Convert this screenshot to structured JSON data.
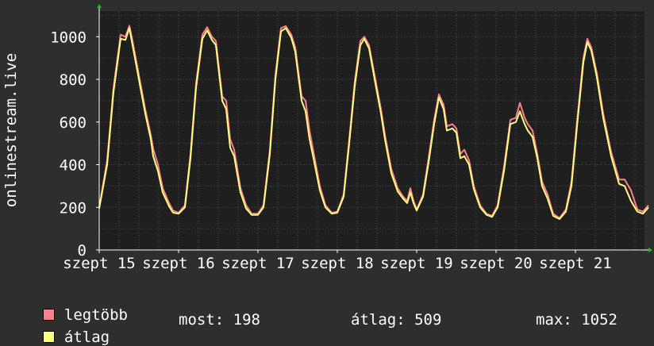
{
  "chart_data": {
    "type": "line",
    "ylabel": "onlinestream.live",
    "ylim": [
      0,
      1120
    ],
    "y_ticks": [
      0,
      200,
      400,
      600,
      800,
      1000
    ],
    "x_tick_labels": [
      "szept 15",
      "szept 16",
      "szept 17",
      "szept 18",
      "szept 19",
      "szept 20",
      "szept 21"
    ],
    "grid": true,
    "background": "#1f1f1f",
    "gridColor": "#4a4a4a",
    "series": [
      {
        "name": "legtöbb",
        "color": "#ff7f8a",
        "points": [
          [
            0,
            200
          ],
          [
            0.1,
            420
          ],
          [
            0.18,
            760
          ],
          [
            0.27,
            1010
          ],
          [
            0.33,
            1000
          ],
          [
            0.38,
            1052
          ],
          [
            0.42,
            980
          ],
          [
            0.5,
            820
          ],
          [
            0.58,
            660
          ],
          [
            0.65,
            540
          ],
          [
            0.68,
            475
          ],
          [
            0.74,
            400
          ],
          [
            0.8,
            290
          ],
          [
            0.88,
            220
          ],
          [
            0.93,
            185
          ],
          [
            1.0,
            175
          ],
          [
            1.08,
            210
          ],
          [
            1.15,
            450
          ],
          [
            1.22,
            780
          ],
          [
            1.3,
            1010
          ],
          [
            1.36,
            1045
          ],
          [
            1.42,
            1000
          ],
          [
            1.47,
            980
          ],
          [
            1.55,
            720
          ],
          [
            1.6,
            700
          ],
          [
            1.65,
            520
          ],
          [
            1.7,
            470
          ],
          [
            1.78,
            290
          ],
          [
            1.85,
            210
          ],
          [
            1.92,
            170
          ],
          [
            2.0,
            170
          ],
          [
            2.07,
            210
          ],
          [
            2.15,
            470
          ],
          [
            2.22,
            820
          ],
          [
            2.29,
            1040
          ],
          [
            2.35,
            1050
          ],
          [
            2.42,
            1010
          ],
          [
            2.47,
            950
          ],
          [
            2.55,
            720
          ],
          [
            2.6,
            700
          ],
          [
            2.65,
            560
          ],
          [
            2.7,
            460
          ],
          [
            2.78,
            300
          ],
          [
            2.85,
            210
          ],
          [
            2.93,
            175
          ],
          [
            3.0,
            180
          ],
          [
            3.08,
            260
          ],
          [
            3.15,
            520
          ],
          [
            3.22,
            790
          ],
          [
            3.29,
            980
          ],
          [
            3.34,
            1000
          ],
          [
            3.4,
            960
          ],
          [
            3.48,
            800
          ],
          [
            3.55,
            660
          ],
          [
            3.6,
            540
          ],
          [
            3.68,
            380
          ],
          [
            3.76,
            290
          ],
          [
            3.83,
            250
          ],
          [
            3.88,
            230
          ],
          [
            3.92,
            290
          ],
          [
            3.96,
            230
          ],
          [
            4.0,
            190
          ],
          [
            4.08,
            260
          ],
          [
            4.15,
            430
          ],
          [
            4.22,
            610
          ],
          [
            4.28,
            730
          ],
          [
            4.34,
            680
          ],
          [
            4.38,
            580
          ],
          [
            4.45,
            590
          ],
          [
            4.5,
            570
          ],
          [
            4.55,
            450
          ],
          [
            4.6,
            470
          ],
          [
            4.66,
            420
          ],
          [
            4.72,
            300
          ],
          [
            4.8,
            210
          ],
          [
            4.88,
            170
          ],
          [
            4.95,
            160
          ],
          [
            5.02,
            210
          ],
          [
            5.1,
            390
          ],
          [
            5.18,
            610
          ],
          [
            5.25,
            620
          ],
          [
            5.3,
            690
          ],
          [
            5.36,
            620
          ],
          [
            5.4,
            590
          ],
          [
            5.46,
            560
          ],
          [
            5.52,
            450
          ],
          [
            5.58,
            320
          ],
          [
            5.65,
            260
          ],
          [
            5.72,
            170
          ],
          [
            5.8,
            150
          ],
          [
            5.88,
            190
          ],
          [
            5.95,
            320
          ],
          [
            6.02,
            600
          ],
          [
            6.1,
            900
          ],
          [
            6.15,
            990
          ],
          [
            6.2,
            950
          ],
          [
            6.27,
            830
          ],
          [
            6.35,
            640
          ],
          [
            6.45,
            460
          ],
          [
            6.55,
            330
          ],
          [
            6.62,
            330
          ],
          [
            6.7,
            280
          ],
          [
            6.78,
            190
          ],
          [
            6.85,
            180
          ],
          [
            6.92,
            210
          ]
        ]
      },
      {
        "name": "átlag",
        "color": "#ffff80",
        "points": [
          [
            0,
            195
          ],
          [
            0.1,
            400
          ],
          [
            0.18,
            740
          ],
          [
            0.27,
            990
          ],
          [
            0.33,
            985
          ],
          [
            0.38,
            1040
          ],
          [
            0.42,
            960
          ],
          [
            0.5,
            800
          ],
          [
            0.58,
            640
          ],
          [
            0.65,
            520
          ],
          [
            0.68,
            440
          ],
          [
            0.74,
            370
          ],
          [
            0.8,
            270
          ],
          [
            0.88,
            205
          ],
          [
            0.93,
            175
          ],
          [
            1.0,
            170
          ],
          [
            1.08,
            200
          ],
          [
            1.15,
            430
          ],
          [
            1.22,
            760
          ],
          [
            1.3,
            990
          ],
          [
            1.36,
            1030
          ],
          [
            1.42,
            985
          ],
          [
            1.47,
            960
          ],
          [
            1.55,
            700
          ],
          [
            1.6,
            660
          ],
          [
            1.65,
            480
          ],
          [
            1.7,
            440
          ],
          [
            1.78,
            270
          ],
          [
            1.85,
            195
          ],
          [
            1.92,
            165
          ],
          [
            2.0,
            165
          ],
          [
            2.07,
            200
          ],
          [
            2.15,
            450
          ],
          [
            2.22,
            800
          ],
          [
            2.29,
            1025
          ],
          [
            2.35,
            1040
          ],
          [
            2.42,
            995
          ],
          [
            2.47,
            930
          ],
          [
            2.55,
            700
          ],
          [
            2.6,
            650
          ],
          [
            2.65,
            520
          ],
          [
            2.7,
            430
          ],
          [
            2.78,
            280
          ],
          [
            2.85,
            200
          ],
          [
            2.93,
            170
          ],
          [
            3.0,
            175
          ],
          [
            3.08,
            250
          ],
          [
            3.15,
            500
          ],
          [
            3.22,
            770
          ],
          [
            3.29,
            960
          ],
          [
            3.34,
            990
          ],
          [
            3.4,
            945
          ],
          [
            3.48,
            780
          ],
          [
            3.55,
            640
          ],
          [
            3.6,
            520
          ],
          [
            3.68,
            360
          ],
          [
            3.76,
            275
          ],
          [
            3.83,
            240
          ],
          [
            3.88,
            220
          ],
          [
            3.92,
            270
          ],
          [
            3.96,
            220
          ],
          [
            4.0,
            185
          ],
          [
            4.08,
            250
          ],
          [
            4.15,
            410
          ],
          [
            4.22,
            590
          ],
          [
            4.28,
            715
          ],
          [
            4.34,
            660
          ],
          [
            4.38,
            560
          ],
          [
            4.45,
            570
          ],
          [
            4.5,
            550
          ],
          [
            4.55,
            430
          ],
          [
            4.6,
            440
          ],
          [
            4.66,
            400
          ],
          [
            4.72,
            285
          ],
          [
            4.8,
            200
          ],
          [
            4.88,
            165
          ],
          [
            4.95,
            155
          ],
          [
            5.02,
            200
          ],
          [
            5.1,
            370
          ],
          [
            5.18,
            590
          ],
          [
            5.25,
            600
          ],
          [
            5.3,
            650
          ],
          [
            5.36,
            590
          ],
          [
            5.4,
            560
          ],
          [
            5.46,
            530
          ],
          [
            5.52,
            430
          ],
          [
            5.58,
            300
          ],
          [
            5.65,
            240
          ],
          [
            5.72,
            160
          ],
          [
            5.8,
            145
          ],
          [
            5.88,
            180
          ],
          [
            5.95,
            300
          ],
          [
            6.02,
            580
          ],
          [
            6.1,
            880
          ],
          [
            6.15,
            975
          ],
          [
            6.2,
            935
          ],
          [
            6.27,
            810
          ],
          [
            6.35,
            620
          ],
          [
            6.45,
            440
          ],
          [
            6.55,
            310
          ],
          [
            6.62,
            300
          ],
          [
            6.7,
            230
          ],
          [
            6.78,
            180
          ],
          [
            6.85,
            170
          ],
          [
            6.92,
            200
          ]
        ]
      }
    ]
  },
  "legend": {
    "max_label": "legtöbb",
    "avg_label": "átlag",
    "now_text": "most: 198",
    "avg_text": "átlag: 509",
    "max_text": "max: 1052"
  },
  "colors": {
    "max": "#ff7f8a",
    "avg": "#ffff80",
    "arrow": "#00cc00"
  }
}
